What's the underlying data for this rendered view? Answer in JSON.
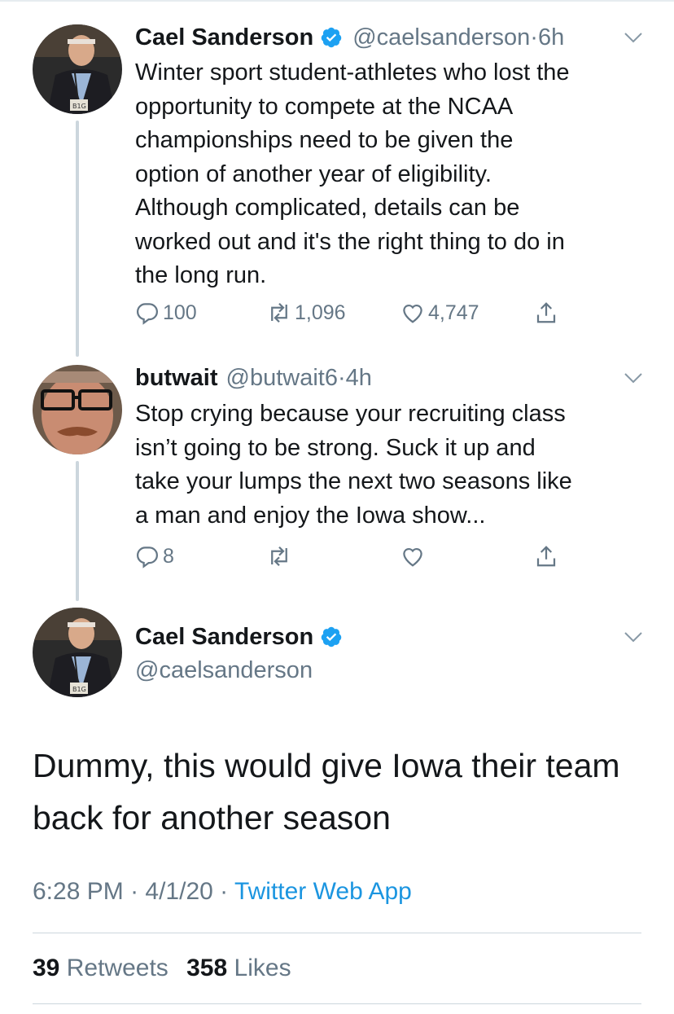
{
  "tweets": [
    {
      "name": "Cael Sanderson",
      "handle": "@caelsanderson",
      "sep": " · ",
      "time": "6h",
      "lines": [
        "Winter sport student-athletes who lost the",
        "opportunity to compete at the NCAA",
        "championships need to be given the",
        "option of another year of eligibility.",
        "Although complicated, details can be",
        "worked out and it's the right thing to do in",
        "the long run."
      ],
      "replies": "100",
      "retweets": "1,096",
      "likes": "4,747"
    },
    {
      "name": "butwait",
      "handle": "@butwait6",
      "sep": " · ",
      "time": "4h",
      "lines": [
        "Stop crying because your recruiting class",
        "isn’t going to be strong. Suck it up and",
        "take your lumps the next two seasons like",
        "a man and enjoy the Iowa show..."
      ],
      "replies": "8"
    }
  ],
  "main": {
    "name": "Cael Sanderson",
    "handle": "@caelsanderson",
    "lines": [
      "Dummy, this would give Iowa their team",
      "back for another season"
    ],
    "time": "6:28 PM",
    "sep1": " · ",
    "date": "4/1/20",
    "sep2": " · ",
    "app": "Twitter Web App",
    "retweet_count": "39",
    "retweet_label": "Retweets",
    "like_count": "358",
    "like_label": "Likes"
  },
  "colors": {
    "verified": "#1da1f2",
    "link": "#1b95e0",
    "secondary": "#657786",
    "thread_line": "#ccd6dd"
  },
  "icons": [
    "reply-icon",
    "retweet-icon",
    "like-icon",
    "share-icon",
    "verified-badge-icon",
    "chevron-down-icon"
  ]
}
